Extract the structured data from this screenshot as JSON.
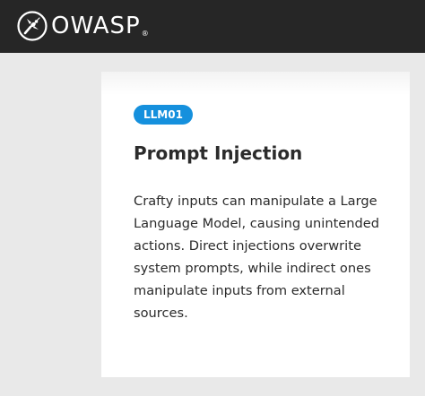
{
  "header": {
    "logo_text": "OWASP",
    "logo_registered": "®",
    "logo_icon": "owasp-wasp-icon"
  },
  "card": {
    "badge": "LLM01",
    "title": "Prompt Injection",
    "description": "Crafty inputs can manipulate a Large Language Model, causing unintended actions. Direct injections overwrite system prompts, while indirect ones manipulate inputs from external sources."
  },
  "colors": {
    "header_bg": "#262626",
    "badge_bg": "#1590dd",
    "text": "#2b2b2b",
    "page_bg": "#e9e9e9",
    "card_bg": "#ffffff"
  }
}
